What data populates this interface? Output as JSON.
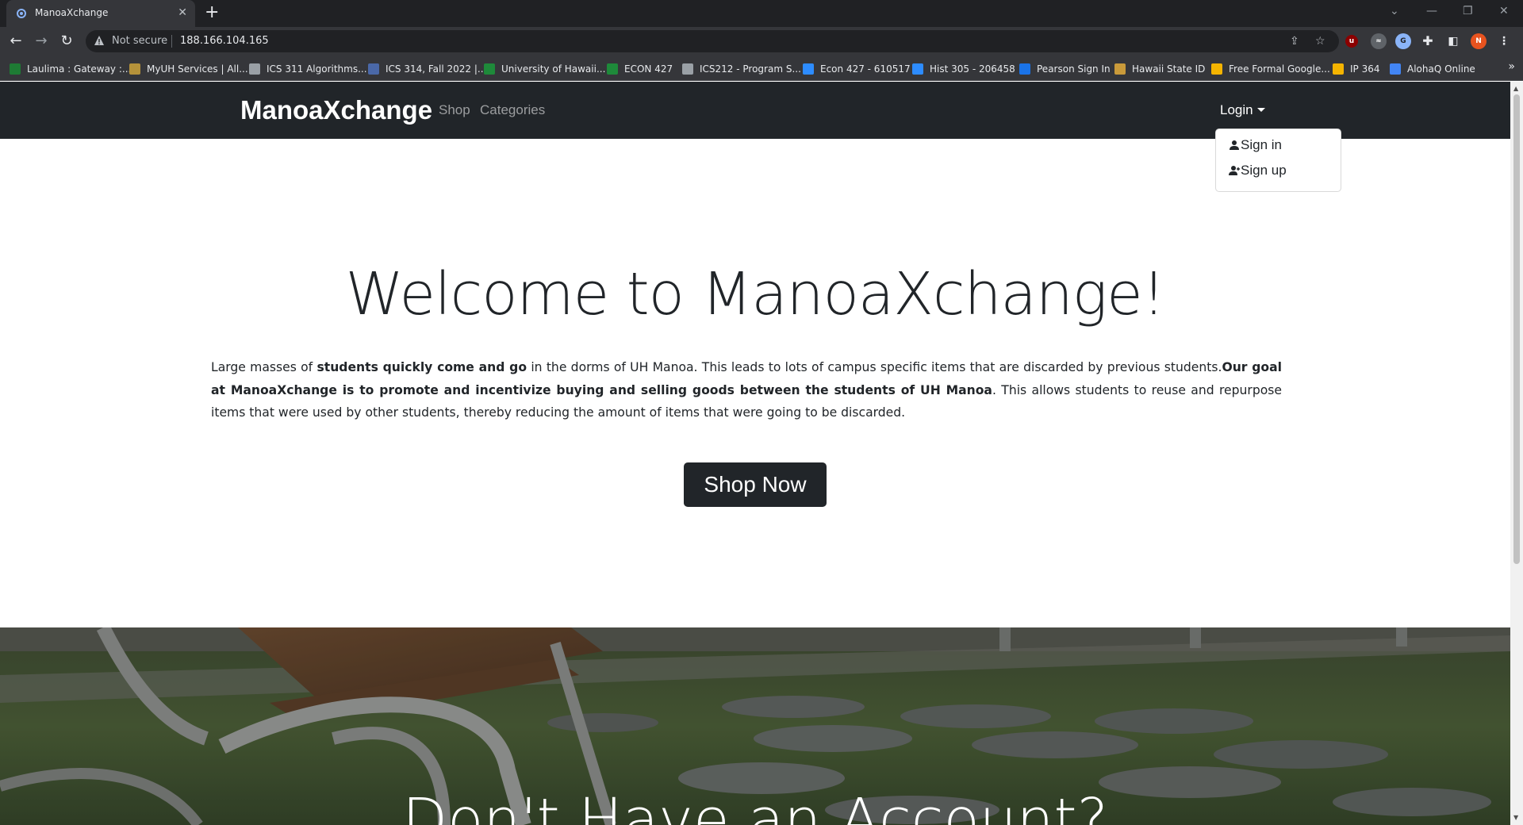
{
  "browser": {
    "tab_title": "ManoaXchange",
    "not_secure": "Not secure",
    "url": "188.166.104.165",
    "profile_initial": "N",
    "bookmarks": [
      {
        "label": "Laulima : Gateway :...",
        "color": "#1e7b34"
      },
      {
        "label": "MyUH Services | All...",
        "color": "#b5923a"
      },
      {
        "label": "ICS 311 Algorithms...",
        "color": "#9aa0a6"
      },
      {
        "label": "ICS 314, Fall 2022 |...",
        "color": "#4a68a8"
      },
      {
        "label": "University of Hawaii...",
        "color": "#1e8a3a"
      },
      {
        "label": "ECON 427",
        "color": "#1e8a3a"
      },
      {
        "label": "ICS212 - Program S...",
        "color": "#9aa0a6"
      },
      {
        "label": "Econ 427 - 610517",
        "color": "#2d8cff"
      },
      {
        "label": "Hist 305 - 206458",
        "color": "#2d8cff"
      },
      {
        "label": "Pearson Sign In",
        "color": "#1a73e8"
      },
      {
        "label": "Hawaii State ID",
        "color": "#c99a3a"
      },
      {
        "label": "Free Formal Google...",
        "color": "#f4b400"
      },
      {
        "label": "IP 364",
        "color": "#f4b400"
      },
      {
        "label": "AlohaQ Online",
        "color": "#4285f4"
      }
    ]
  },
  "navbar": {
    "brand": "ManoaXchange",
    "links": [
      "Shop",
      "Categories"
    ],
    "login": "Login"
  },
  "dropdown": {
    "items": [
      "Sign in",
      "Sign up"
    ]
  },
  "hero": {
    "title": "Welcome to ManoaXchange!",
    "intro_1": "Large masses of ",
    "intro_2": "students quickly come and go",
    "intro_3": " in the dorms of UH Manoa. This leads to lots of campus specific items that are discarded by previous students.",
    "intro_4": "Our goal at ManoaXchange is to promote and incentivize buying and selling goods between the students of UH Manoa",
    "intro_5": ". This allows students to reuse and repurpose items that were used by other students, thereby reducing the amount of items that were going to be discarded.",
    "button": "Shop Now"
  },
  "signup_section": {
    "title": "Don't Have an Account?"
  }
}
